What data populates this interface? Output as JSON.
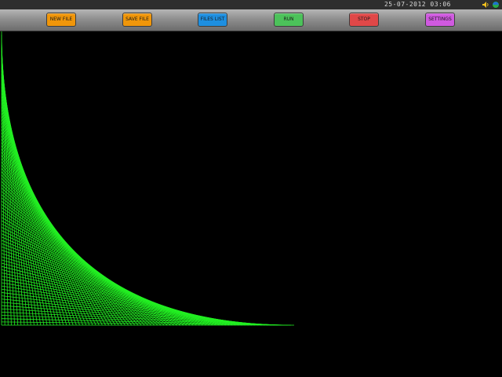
{
  "status_bar": {
    "datetime": "25-07-2012 03:06",
    "icons": [
      "speaker-icon",
      "network-icon"
    ]
  },
  "toolbar": {
    "buttons": [
      {
        "label": "NEW FILE",
        "color": "#f0960a"
      },
      {
        "label": "SAVE FILE",
        "color": "#f0960a"
      },
      {
        "label": "FILES LIST",
        "color": "#1e8fe0"
      },
      {
        "label": "RUN",
        "color": "#4cc25a"
      },
      {
        "label": "STOP",
        "color": "#e04848"
      },
      {
        "label": "SETTINGS",
        "color": "#d05ae0"
      }
    ]
  },
  "canvas": {
    "background": "#000000",
    "line_color": "#22ee22",
    "drawing": "line-envelope curve grid"
  }
}
